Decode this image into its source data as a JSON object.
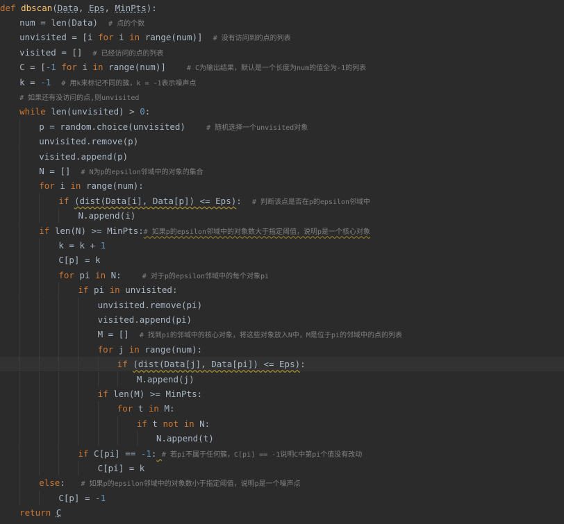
{
  "colors": {
    "background": "#2b2b2b",
    "current_line": "#323232",
    "default": "#a9b7c6",
    "keyword": "#cc7832",
    "function": "#ffc66d",
    "number": "#6897bb",
    "comment": "#808080",
    "warning_underline": "#a28c2e"
  },
  "current_line_index": 24,
  "lines": [
    {
      "indent": 0,
      "tokens": [
        [
          "kw",
          "def "
        ],
        [
          "fn",
          "dbscan"
        ],
        [
          "t",
          "("
        ],
        [
          "param",
          "Data"
        ],
        [
          "t",
          ", "
        ],
        [
          "param",
          "Eps"
        ],
        [
          "t",
          ", "
        ],
        [
          "param",
          "MinPts"
        ],
        [
          "t",
          "):"
        ]
      ]
    },
    {
      "indent": 1,
      "tokens": [
        [
          "t",
          "num = len(Data)  "
        ],
        [
          "cmt",
          "# 点的个数"
        ]
      ]
    },
    {
      "indent": 1,
      "tokens": [
        [
          "t",
          "unvisited = [i "
        ],
        [
          "kw",
          "for"
        ],
        [
          "t",
          " i "
        ],
        [
          "kw",
          "in"
        ],
        [
          "t",
          " range(num)]  "
        ],
        [
          "cmt",
          "# 没有访问到的点的列表"
        ]
      ]
    },
    {
      "indent": 1,
      "tokens": [
        [
          "t",
          "visited = []  "
        ],
        [
          "cmt",
          "# 已经访问的点的列表"
        ]
      ]
    },
    {
      "indent": 1,
      "tokens": [
        [
          "t",
          "C = ["
        ],
        [
          "num",
          "-1"
        ],
        [
          "t",
          " "
        ],
        [
          "kw",
          "for"
        ],
        [
          "t",
          " i "
        ],
        [
          "kw",
          "in"
        ],
        [
          "t",
          " range(num)]    "
        ],
        [
          "cmt",
          "# C为输出结果，默认是一个长度为num的值全为-1的列表"
        ]
      ]
    },
    {
      "indent": 1,
      "tokens": [
        [
          "t",
          "k = "
        ],
        [
          "num",
          "-1"
        ],
        [
          "t",
          "  "
        ],
        [
          "cmt",
          "# 用k来标记不同的簇，k = -1表示噪声点"
        ]
      ]
    },
    {
      "indent": 1,
      "tokens": [
        [
          "cmt",
          "# 如果还有没访问的点,则unvisited"
        ]
      ]
    },
    {
      "indent": 1,
      "tokens": [
        [
          "kw",
          "while"
        ],
        [
          "t",
          " len(unvisited) > "
        ],
        [
          "num",
          "0"
        ],
        [
          "t",
          ":"
        ]
      ]
    },
    {
      "indent": 2,
      "tokens": [
        [
          "t",
          "p = random.choice(unvisited)    "
        ],
        [
          "cmt",
          "# 随机选择一个unvisited对象"
        ]
      ]
    },
    {
      "indent": 2,
      "tokens": [
        [
          "t",
          "unvisited.remove(p)"
        ]
      ]
    },
    {
      "indent": 2,
      "tokens": [
        [
          "t",
          "visited.append(p)"
        ]
      ]
    },
    {
      "indent": 2,
      "tokens": [
        [
          "t",
          "N = []  "
        ],
        [
          "cmt",
          "# N为p的epsilon邻域中的对象的集合"
        ]
      ]
    },
    {
      "indent": 2,
      "tokens": [
        [
          "kw",
          "for"
        ],
        [
          "t",
          " i "
        ],
        [
          "kw",
          "in"
        ],
        [
          "t",
          " range(num):"
        ]
      ]
    },
    {
      "indent": 3,
      "tokens": [
        [
          "kw",
          "if"
        ],
        [
          "t",
          " "
        ],
        [
          "warn",
          "(dist(Data[i], Data[p]) <= Eps)"
        ],
        [
          "t",
          ":  "
        ],
        [
          "cmt",
          "# 判断该点是否在p的epsilon邻域中"
        ]
      ]
    },
    {
      "indent": 4,
      "tokens": [
        [
          "t",
          "N.append(i)"
        ]
      ]
    },
    {
      "indent": 2,
      "tokens": [
        [
          "kw",
          "if"
        ],
        [
          "t",
          " len(N) >= MinPts:"
        ],
        [
          "warn",
          "# 如果p的epsilon邻域中的对象数大于指定阈值，说明p是一个核心对象"
        ]
      ]
    },
    {
      "indent": 3,
      "tokens": [
        [
          "t",
          "k = k + "
        ],
        [
          "num",
          "1"
        ]
      ]
    },
    {
      "indent": 3,
      "tokens": [
        [
          "t",
          "C[p] = k"
        ]
      ]
    },
    {
      "indent": 3,
      "tokens": [
        [
          "kw",
          "for"
        ],
        [
          "t",
          " pi "
        ],
        [
          "kw",
          "in"
        ],
        [
          "t",
          " N:    "
        ],
        [
          "cmt",
          "# 对于p的epsilon邻域中的每个对象pi"
        ]
      ]
    },
    {
      "indent": 4,
      "tokens": [
        [
          "kw",
          "if"
        ],
        [
          "t",
          " pi "
        ],
        [
          "kw",
          "in"
        ],
        [
          "t",
          " unvisited:"
        ]
      ]
    },
    {
      "indent": 5,
      "tokens": [
        [
          "t",
          "unvisited.remove(pi)"
        ]
      ]
    },
    {
      "indent": 5,
      "tokens": [
        [
          "t",
          "visited.append(pi)"
        ]
      ]
    },
    {
      "indent": 5,
      "tokens": [
        [
          "t",
          "M = []  "
        ],
        [
          "cmt",
          "# 找到pi的邻域中的核心对象，将这些对象放入N中，M是位于pi的邻域中的点的列表"
        ]
      ]
    },
    {
      "indent": 5,
      "tokens": [
        [
          "kw",
          "for"
        ],
        [
          "t",
          " j "
        ],
        [
          "kw",
          "in"
        ],
        [
          "t",
          " range(num):"
        ]
      ]
    },
    {
      "indent": 6,
      "tokens": [
        [
          "kw",
          "if"
        ],
        [
          "t",
          " "
        ],
        [
          "warn",
          "(dist(Data[j], Data[pi]) <= Eps)"
        ],
        [
          "t",
          ":"
        ]
      ]
    },
    {
      "indent": 7,
      "tokens": [
        [
          "t",
          "M.append(j)"
        ]
      ]
    },
    {
      "indent": 5,
      "tokens": [
        [
          "kw",
          "if"
        ],
        [
          "t",
          " len(M) >= MinPts:"
        ]
      ]
    },
    {
      "indent": 6,
      "tokens": [
        [
          "kw",
          "for"
        ],
        [
          "t",
          " t "
        ],
        [
          "kw",
          "in"
        ],
        [
          "t",
          " M:"
        ]
      ]
    },
    {
      "indent": 7,
      "tokens": [
        [
          "kw",
          "if"
        ],
        [
          "t",
          " t "
        ],
        [
          "kw",
          "not in"
        ],
        [
          "t",
          " N:"
        ]
      ]
    },
    {
      "indent": 8,
      "tokens": [
        [
          "t",
          "N.append(t)"
        ]
      ]
    },
    {
      "indent": 4,
      "tokens": [
        [
          "kw",
          "if"
        ],
        [
          "t",
          " C[pi] == "
        ],
        [
          "num",
          "-1"
        ],
        [
          "t",
          ":"
        ],
        [
          "warn",
          " "
        ],
        [
          "cmt",
          "# 若pi不属于任何簇，C[pi] == -1说明C中第pi个值没有改动"
        ]
      ]
    },
    {
      "indent": 5,
      "tokens": [
        [
          "t",
          "C[pi] = k"
        ]
      ]
    },
    {
      "indent": 2,
      "tokens": [
        [
          "kw",
          "else"
        ],
        [
          "t",
          ":   "
        ],
        [
          "cmt",
          "# 如果p的epsilon邻域中的对象数小于指定阈值，说明p是一个噪声点"
        ]
      ]
    },
    {
      "indent": 3,
      "tokens": [
        [
          "t",
          "C[p] = "
        ],
        [
          "num",
          "-1"
        ]
      ]
    },
    {
      "indent": 1,
      "tokens": [
        [
          "kw",
          "return"
        ],
        [
          "t",
          " "
        ],
        [
          "param",
          "C"
        ]
      ]
    }
  ]
}
